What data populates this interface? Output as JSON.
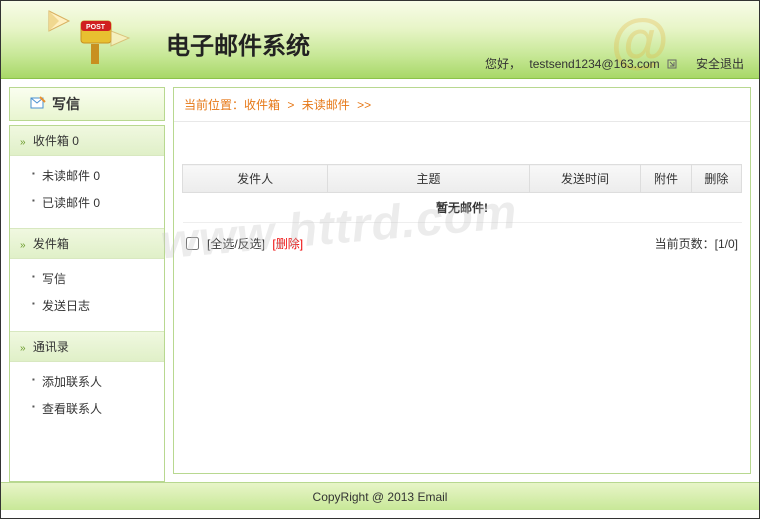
{
  "header": {
    "title": "电子邮件系统",
    "welcome_prefix": "您好，",
    "user_email": "testsend1234@163.com",
    "logout_label": "安全退出"
  },
  "sidebar": {
    "compose_label": "写信",
    "sections": [
      {
        "title": "收件箱 0",
        "items": [
          {
            "label": "未读邮件 0"
          },
          {
            "label": "已读邮件 0"
          }
        ]
      },
      {
        "title": "发件箱",
        "items": [
          {
            "label": "写信"
          },
          {
            "label": "发送日志"
          }
        ]
      },
      {
        "title": "通讯录",
        "items": [
          {
            "label": "添加联系人"
          },
          {
            "label": "查看联系人"
          }
        ]
      }
    ]
  },
  "breadcrumb": {
    "prefix": "当前位置：",
    "parts": [
      "收件箱",
      "未读邮件"
    ],
    "sep": ">",
    "tail": ">>"
  },
  "table": {
    "headers": {
      "sender": "发件人",
      "subject": "主题",
      "time": "发送时间",
      "attachment": "附件",
      "delete": "删除"
    },
    "empty_message": "暂无邮件!"
  },
  "controls": {
    "select_toggle": "[全选/反选]",
    "delete_selected": "[删除]",
    "page_label": "当前页数：",
    "page_value": "[1/0]"
  },
  "footer": {
    "text": "CopyRight @ 2013 Email"
  },
  "watermark": "www.httrd.com"
}
